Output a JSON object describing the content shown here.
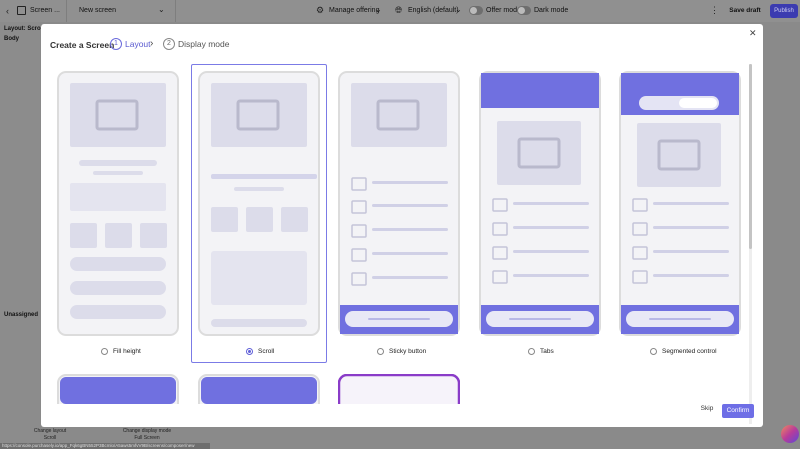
{
  "topbar": {
    "screen_label": "Screen ...",
    "new_screen": "New screen",
    "manage_offering": "Manage offering",
    "language": "English (default)",
    "offer_mode": "Offer mode",
    "dark_mode": "Dark mode",
    "save_draft": "Save draft",
    "publish": "Publish"
  },
  "left_panel": {
    "layout_label": "Layout: Scroll",
    "body_label": "Body",
    "unassigned_label": "Unassigned"
  },
  "bottom_bar": {
    "change_layout": "Change layout",
    "layout_value": "Scroll",
    "change_display_mode": "Change display mode",
    "display_mode_value": "Full Screen",
    "status_url": "https://console.purchasely.io/app_Fqk6gBN552P3Bcmlo/A5aws5mfvV9B/screens/composer/new"
  },
  "modal": {
    "title": "Create a Screen",
    "steps": [
      {
        "number": "1",
        "label": "Layout"
      },
      {
        "number": "2",
        "label": "Display mode"
      }
    ],
    "options": [
      {
        "label": "Fill height",
        "selected": false
      },
      {
        "label": "Scroll",
        "selected": true
      },
      {
        "label": "Sticky button",
        "selected": false
      },
      {
        "label": "Tabs",
        "selected": false
      },
      {
        "label": "Segmented control",
        "selected": false
      }
    ],
    "skip": "Skip",
    "confirm": "Confirm"
  },
  "colors": {
    "accent": "#6e6ee6",
    "phone_accent": "#6c6ce4"
  }
}
